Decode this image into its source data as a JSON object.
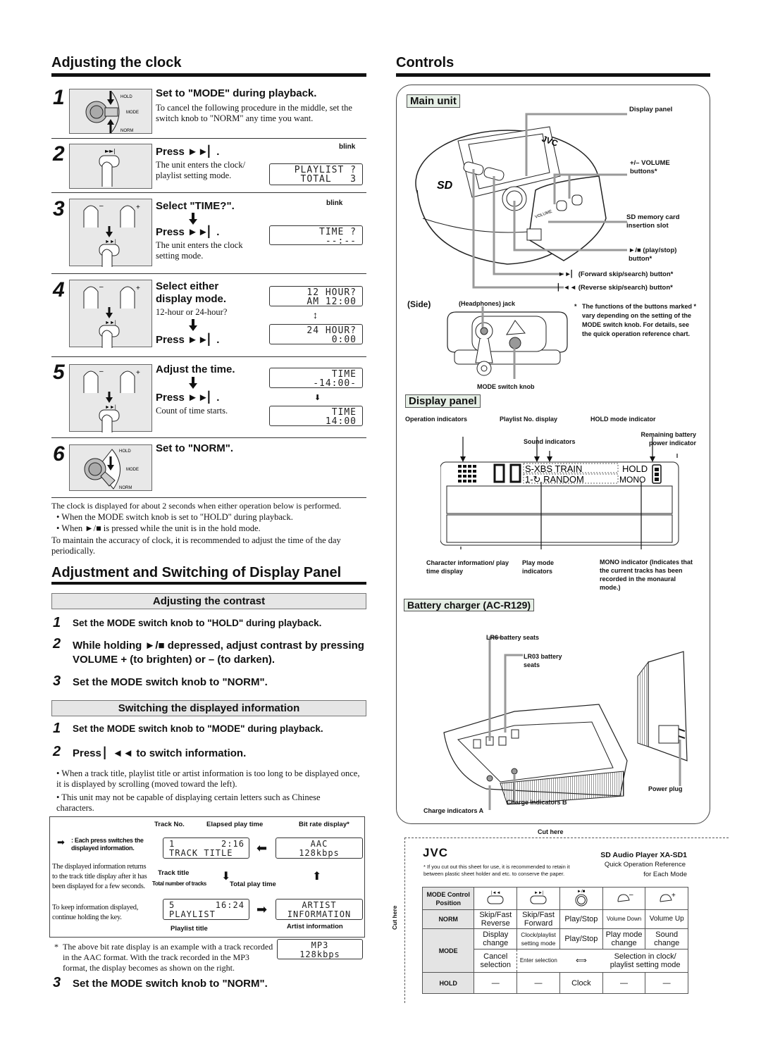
{
  "clock": {
    "title": "Adjusting the clock",
    "steps": [
      {
        "num": "1",
        "title": "Set to \"MODE\" during playback.",
        "text": "To cancel the following procedure in the middle, set the switch knob to \"NORM\" any time you want.",
        "knob_labels": [
          "HOLD",
          "MODE",
          "NORM"
        ]
      },
      {
        "num": "2",
        "title": "Press ►►▏.",
        "text": "The unit enters the clock/ playlist setting mode.",
        "lcd": [
          "PLAYLIST ?",
          "TOTAL   3"
        ],
        "blink": "blink"
      },
      {
        "num": "3",
        "title": "Select \"TIME?\".",
        "title2": "Press ►►▏.",
        "text": "The unit enters the clock setting mode.",
        "lcd": [
          "TIME ?",
          "--:--"
        ],
        "blink": "blink"
      },
      {
        "num": "4",
        "title": "Select either display mode.",
        "text": "12-hour or 24-hour?",
        "title2": "Press ►►▏.",
        "lcd_a": [
          "12 HOUR?",
          "AM 12:00"
        ],
        "lcd_b": [
          "24 HOUR?",
          "0:00"
        ]
      },
      {
        "num": "5",
        "title": "Adjust the time.",
        "title2": "Press ►►▏.",
        "text": "Count of time starts.",
        "lcd_a": [
          "TIME",
          "-14:00-"
        ],
        "lcd_b": [
          "TIME",
          "14:00"
        ]
      },
      {
        "num": "6",
        "title": "Set to \"NORM\".",
        "knob_labels": [
          "HOLD",
          "MODE",
          "NORM"
        ]
      }
    ],
    "note_intro": "The clock is displayed for about 2 seconds when either operation below is performed.",
    "note_bullets": [
      "When the MODE switch knob is set to \"HOLD\" during playback.",
      "When ►/■ is pressed while the unit is in the hold mode."
    ],
    "note_end": "To maintain the accuracy of clock, it is recommended to adjust the time of the day periodically."
  },
  "display_adjust": {
    "title": "Adjustment and Switching of Display Panel",
    "contrast": {
      "title": "Adjusting the contrast",
      "steps": [
        {
          "num": "1",
          "text": "Set the MODE switch knob to \"HOLD\" during playback."
        },
        {
          "num": "2",
          "text": "While holding ►/■ depressed, adjust contrast by pressing VOLUME + (to brighten) or – (to darken)."
        },
        {
          "num": "3",
          "text": "Set the MODE switch knob to \"NORM\"."
        }
      ]
    },
    "switching": {
      "title": "Switching the displayed information",
      "steps": [
        {
          "num": "1",
          "text": "Set the MODE switch knob to \"MODE\" during playback."
        },
        {
          "num": "2",
          "text": "Press ▏◄◄ to switch information."
        }
      ],
      "bullets": [
        "When a track title, playlist title or artist information is too long to be displayed once, it is displayed by scrolling (moved toward the left).",
        "This unit may not be capable of displaying certain letters such as Chinese characters."
      ],
      "diagram": {
        "legend": ": Each press switches the displayed information.",
        "side_text": "The displayed information returns to the track title display after it has been displayed for a few seconds.",
        "side_text2": "To keep information displayed, continue holding the key.",
        "labels": {
          "track_no": "Track No.",
          "elapsed": "Elapsed play time",
          "bitrate": "Bit rate display*",
          "track_title": "Track title",
          "total_tracks": "Total number of tracks",
          "total_time": "Total play time",
          "playlist_title": "Playlist title",
          "artist_info": "Artist information"
        },
        "lcd_track": [
          "1        2:16",
          "TRACK TITLE"
        ],
        "lcd_bitrate": [
          "AAC",
          "128kbps"
        ],
        "lcd_playlist": [
          "5       16:24",
          "PLAYLIST"
        ],
        "lcd_artist": [
          "ARTIST",
          "INFORMATION"
        ]
      },
      "footnote": "The above bit rate display is an example with a track recorded in the AAC format. With the track recorded in the MP3 format, the display becomes as shown on the right.",
      "lcd_mp3": [
        "MP3",
        "128kbps"
      ],
      "step3": {
        "num": "3",
        "text": "Set the MODE switch knob to \"NORM\"."
      }
    }
  },
  "controls": {
    "title": "Controls",
    "main_unit": {
      "tag": "Main unit",
      "callouts": [
        "Display panel",
        "+/– VOLUME buttons*",
        "SD memory card insertion slot",
        "►/■ (play/stop) button*",
        "►►▏ (Forward skip/search) button*",
        "▏◄◄ (Reverse skip/search) button*"
      ],
      "brand": "JVC",
      "volume_label": "VOLUME"
    },
    "side": {
      "label": "(Side)",
      "headphones": "(Headphones) jack",
      "mode_knob": "MODE switch knob",
      "note": "The functions of the buttons marked * vary depending on the setting of the MODE switch knob. For details, see the quick operation reference chart."
    },
    "display_panel": {
      "tag": "Display panel",
      "labels": {
        "operation": "Operation indicators",
        "playlist_no": "Playlist No. display",
        "hold_ind": "HOLD mode indicator",
        "sound": "Sound indicators",
        "battery": "Remaining battery power indicator",
        "char_info": "Character information/ play time display",
        "play_mode": "Play mode indicators",
        "mono": "MONO indicator (Indicates that the current tracks has been recorded in the monaural mode.)"
      },
      "segments": {
        "sound": "S-XBS TRAIN",
        "hold": "HOLD",
        "playmode": "1-↻ RANDOM",
        "mono": "MONO"
      }
    },
    "charger": {
      "tag": "Battery charger (AC-R129)",
      "labels": {
        "lr6": "LR6 battery seats",
        "lr03": "LR03 battery seats",
        "charge_a": "Charge indicators A",
        "charge_b": "Charge indicators B",
        "plug": "Power plug"
      }
    }
  },
  "reference_card": {
    "cut_here": "Cut here",
    "brand": "JVC",
    "product": "SD Audio Player XA-SD1",
    "subtitle1": "Quick Operation Reference",
    "subtitle2": "for Each Mode",
    "note": "* If you cut out this sheet for use, it is recommended to retain it between plastic sheet holder and etc. to conserve the paper.",
    "header": "MODE Control Position",
    "rows": {
      "norm": {
        "label": "NORM",
        "cells": [
          "Skip/Fast Reverse",
          "Skip/Fast Forward",
          "Play/Stop",
          "Volume Down",
          "Volume Up"
        ]
      },
      "mode": {
        "label": "MODE",
        "cells": [
          "Display change",
          "Clock/playlist setting mode",
          "Play/Stop",
          "Play mode change",
          "Sound change"
        ],
        "sub": [
          "Cancel selection",
          "Enter selection",
          "Selection in clock/ playlist setting mode"
        ]
      },
      "hold": {
        "label": "HOLD",
        "cells": [
          "—",
          "—",
          "Clock",
          "—",
          "—"
        ]
      }
    }
  }
}
